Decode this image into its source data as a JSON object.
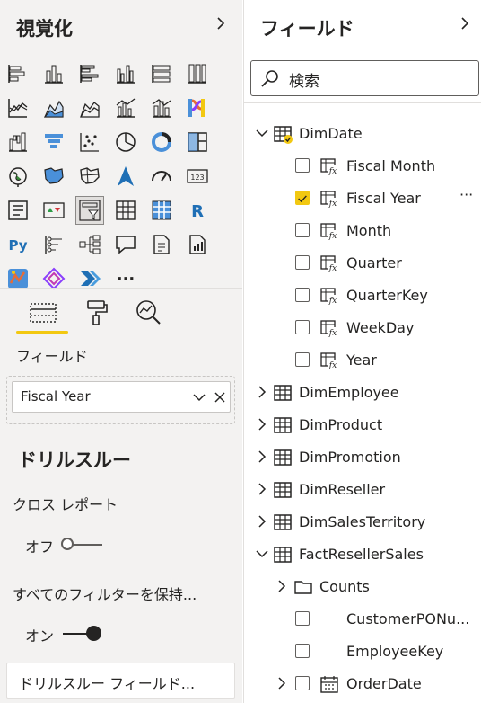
{
  "left_pane": {
    "title": "視覚化",
    "viz_icons": [
      "stacked-bar-chart-icon",
      "stacked-column-chart-icon",
      "clustered-bar-chart-icon",
      "clustered-column-chart-icon",
      "100-stacked-bar-chart-icon",
      "100-stacked-column-chart-icon",
      "line-chart-icon",
      "area-chart-icon",
      "stacked-area-chart-icon",
      "line-clustered-column-chart-icon",
      "line-stacked-column-chart-icon",
      "ribbon-chart-icon",
      "waterfall-chart-icon",
      "funnel-chart-icon",
      "scatter-chart-icon",
      "pie-chart-icon",
      "donut-chart-icon",
      "treemap-icon",
      "map-icon",
      "filled-map-icon",
      "shape-map-icon",
      "azure-map-icon",
      "gauge-icon",
      "card-icon",
      "multi-row-card-icon",
      "kpi-icon",
      "slicer-icon",
      "table-icon",
      "matrix-icon",
      "r-visual-icon",
      "python-visual-icon",
      "key-influencers-icon",
      "decomposition-tree-icon",
      "qa-icon",
      "paginated-report-icon",
      "smart-narrative-icon",
      "arcgis-map-icon",
      "power-apps-icon",
      "power-automate-icon",
      "more-visuals-icon"
    ],
    "more_label": "···",
    "tabs": [
      "fields-tab-icon",
      "format-paintroller-icon",
      "analytics-magnifier-icon"
    ],
    "fields_label": "フィールド",
    "well_value": "Fiscal Year",
    "drillthrough_title": "ドリルスルー",
    "cross_report_label": "クロス レポート",
    "cross_report_state": "オフ",
    "keep_filters_label": "すべてのフィルターを保持...",
    "keep_filters_state": "オン",
    "drillthrough_field_placeholder": "ドリルスルー フィールド..."
  },
  "right_pane": {
    "title": "フィールド",
    "search_placeholder": "検索",
    "tree": [
      {
        "label": "DimDate",
        "kind": "table",
        "expanded": true,
        "indent": 0,
        "has_checked": true
      },
      {
        "label": "Fiscal Month",
        "kind": "calc",
        "checked": false,
        "indent": 1
      },
      {
        "label": "Fiscal Year",
        "kind": "calc",
        "checked": true,
        "indent": 1,
        "more": "···"
      },
      {
        "label": "Month",
        "kind": "calc",
        "checked": false,
        "indent": 1
      },
      {
        "label": "Quarter",
        "kind": "calc",
        "checked": false,
        "indent": 1
      },
      {
        "label": "QuarterKey",
        "kind": "calc",
        "checked": false,
        "indent": 1
      },
      {
        "label": "WeekDay",
        "kind": "calc",
        "checked": false,
        "indent": 1
      },
      {
        "label": "Year",
        "kind": "calc",
        "checked": false,
        "indent": 1
      },
      {
        "label": "DimEmployee",
        "kind": "table",
        "expanded": false,
        "indent": 0
      },
      {
        "label": "DimProduct",
        "kind": "table",
        "expanded": false,
        "indent": 0
      },
      {
        "label": "DimPromotion",
        "kind": "table",
        "expanded": false,
        "indent": 0
      },
      {
        "label": "DimReseller",
        "kind": "table",
        "expanded": false,
        "indent": 0
      },
      {
        "label": "DimSalesTerritory",
        "kind": "table",
        "expanded": false,
        "indent": 0
      },
      {
        "label": "FactResellerSales",
        "kind": "table",
        "expanded": true,
        "indent": 0
      },
      {
        "label": "Counts",
        "kind": "folder",
        "expanded": false,
        "indent": 1
      },
      {
        "label": "CustomerPONu...",
        "kind": "field",
        "checked": false,
        "indent": 1
      },
      {
        "label": "EmployeeKey",
        "kind": "field",
        "checked": false,
        "indent": 1
      },
      {
        "label": "OrderDate",
        "kind": "date",
        "checked": false,
        "expanded": false,
        "indent": 1
      }
    ]
  },
  "colors": {
    "accent": "#f2c811",
    "text": "#252423",
    "pane_bg": "#f3f2f1",
    "border": "#c8c6c4"
  }
}
